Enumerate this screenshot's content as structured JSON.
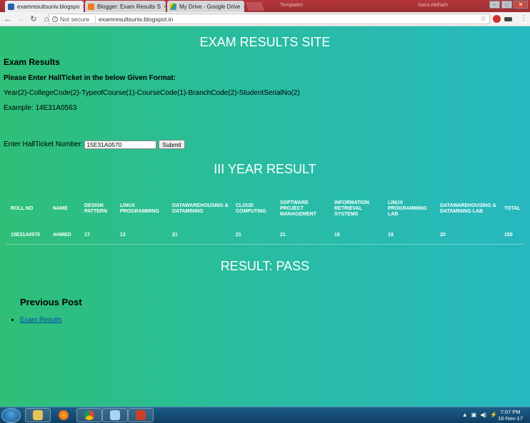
{
  "browser": {
    "tabs": [
      {
        "title": "examresultsuniv.blogspo",
        "active": true
      },
      {
        "title": "Blogger: Exam Results S",
        "active": false
      },
      {
        "title": "My Drive - Google Drive",
        "active": false
      }
    ],
    "ghost_tab": "Templates",
    "profile_name": "Saira Aktharh",
    "security_label": "Not secure",
    "url": "examresultsuniv.blogspot.in",
    "colors": {
      "tabstrip": "#b5373c",
      "page_gradient_start": "#2fbf77",
      "page_gradient_end": "#27b8c0"
    }
  },
  "page": {
    "site_title": "EXAM RESULTS SITE",
    "heading": "Exam Results",
    "instruction": "Please Enter HallTicket in the below Given Format:",
    "format": "Year(2)-CollegeCode(2)-TypeofCourse(1)-CourseCode(1)-BranchCode(2)-StudentSerialNo(2)",
    "example": "Example: 14E31A0563",
    "form": {
      "label": "Enter HallTicket Number:",
      "value": "15E31A0570",
      "submit_label": "Submit"
    },
    "year_title": "III YEAR RESULT",
    "table": {
      "headers": [
        "ROLL NO",
        "NAME",
        "DESIGN PATTERN",
        "LINUX PROGRAMMING",
        "DATAWAREHOUSING & DATAMINING",
        "CLOUD COMPUTING",
        "SOFTWARE PROJECT MANAGEMENT",
        "INFORMATION RETRIEVAL SYSTEMS",
        "LINUX PROGRAMMING LAB",
        "DATAWAREHOUSING & DATAMINING LAB",
        "TOTAL"
      ],
      "row": [
        "15E31A0570",
        "AHMED",
        "17",
        "13",
        "21",
        "21",
        "21",
        "18",
        "19",
        "20",
        "150"
      ]
    },
    "result": "RESULT: PASS",
    "previous_post_heading": "Previous Post",
    "previous_post_link": "Exam Results"
  },
  "taskbar": {
    "time": "7:07 PM",
    "date": "16-Nov-17",
    "apps": [
      "file-explorer-icon",
      "firefox-icon",
      "chrome-icon",
      "notepad-icon",
      "powerpoint-icon"
    ]
  }
}
